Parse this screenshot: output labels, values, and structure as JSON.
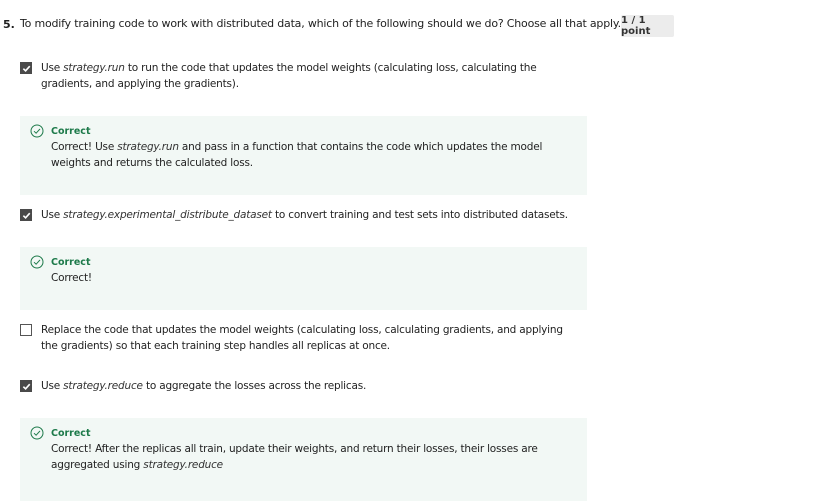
{
  "question": {
    "number": "5.",
    "text": "To modify training code to work with distributed data, which of the following should we do? Choose all that apply.",
    "points": "1 / 1 point"
  },
  "options": [
    {
      "checked": true,
      "pre": "Use ",
      "code": "strategy.run",
      "post": " to run the code that updates the model weights (calculating loss, calculating the gradients, and applying the gradients)."
    },
    {
      "checked": true,
      "pre": "Use ",
      "code": "strategy.experimental_distribute_dataset",
      "post": " to convert training and test sets into distributed datasets."
    },
    {
      "checked": false,
      "pre": "Replace the code that updates the model weights (calculating loss, calculating gradients, and applying the gradients) so that each training step handles all replicas at once.",
      "code": "",
      "post": ""
    },
    {
      "checked": true,
      "pre": "Use ",
      "code": "strategy.reduce",
      "post": " to aggregate the losses across the replicas."
    }
  ],
  "feedback": [
    {
      "label": "Correct",
      "pre": "Correct! Use ",
      "code": "strategy.run",
      "post": " and pass in a function that contains the code which updates the model weights and returns the calculated loss."
    },
    {
      "label": "Correct",
      "pre": "Correct!",
      "code": "",
      "post": ""
    },
    {
      "label": "Correct",
      "pre": "Correct! After the replicas all train, update their weights, and return their losses, their losses are aggregated using ",
      "code": "strategy.reduce",
      "post": ""
    }
  ],
  "colors": {
    "correct_green": "#1d7a4a",
    "feedback_bg": "#f2f8f5",
    "checkbox_fill": "#4a4a4a"
  },
  "icons": {
    "checkmark": "check-icon",
    "correct": "check-circle-icon"
  }
}
